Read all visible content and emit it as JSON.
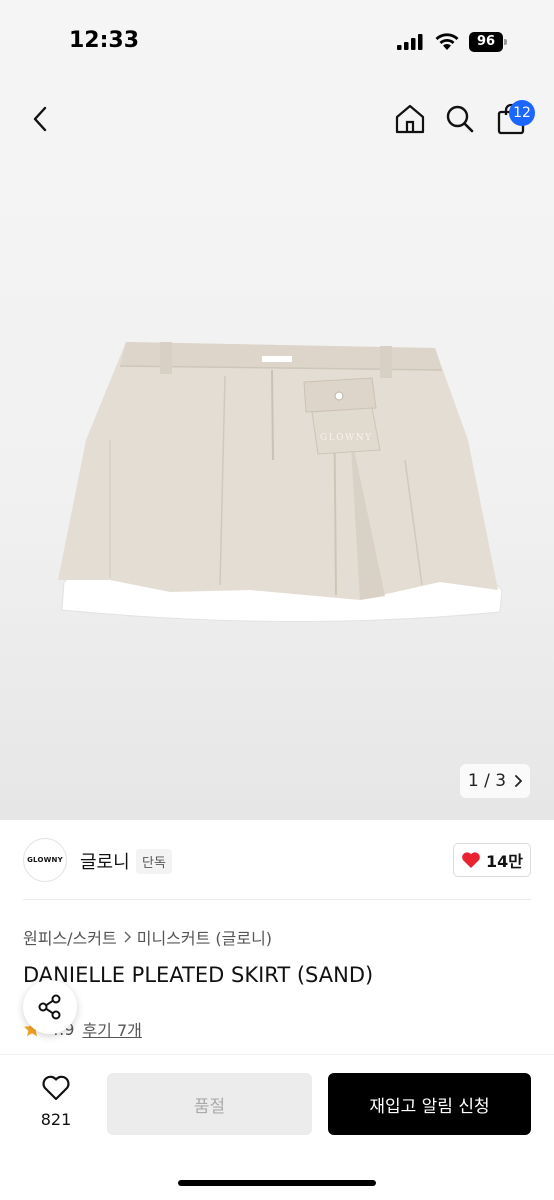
{
  "status_bar": {
    "time": "12:33",
    "battery": "96"
  },
  "nav": {
    "cart_count": "12"
  },
  "gallery": {
    "pager_text": "1 / 3"
  },
  "brand": {
    "logo_text": "GLOWNY",
    "name": "글로니",
    "badge": "단독",
    "likes": "14만"
  },
  "breadcrumb": {
    "category": "원피스/스커트",
    "subcategory": "미니스커트 (글로니)"
  },
  "product": {
    "title": "DANIELLE PLEATED SKIRT (SAND)",
    "rating": "4.9",
    "reviews": "후기 7개",
    "embroidery": "GLOWNY"
  },
  "bottom_bar": {
    "wish_count": "821",
    "soldout_label": "품절",
    "notify_label": "재입고 알림 신청"
  },
  "colors": {
    "accent_badge": "#1a66ff",
    "heart": "#e8232f",
    "star": "#f5a623",
    "skirt": "#e4ddd3"
  }
}
